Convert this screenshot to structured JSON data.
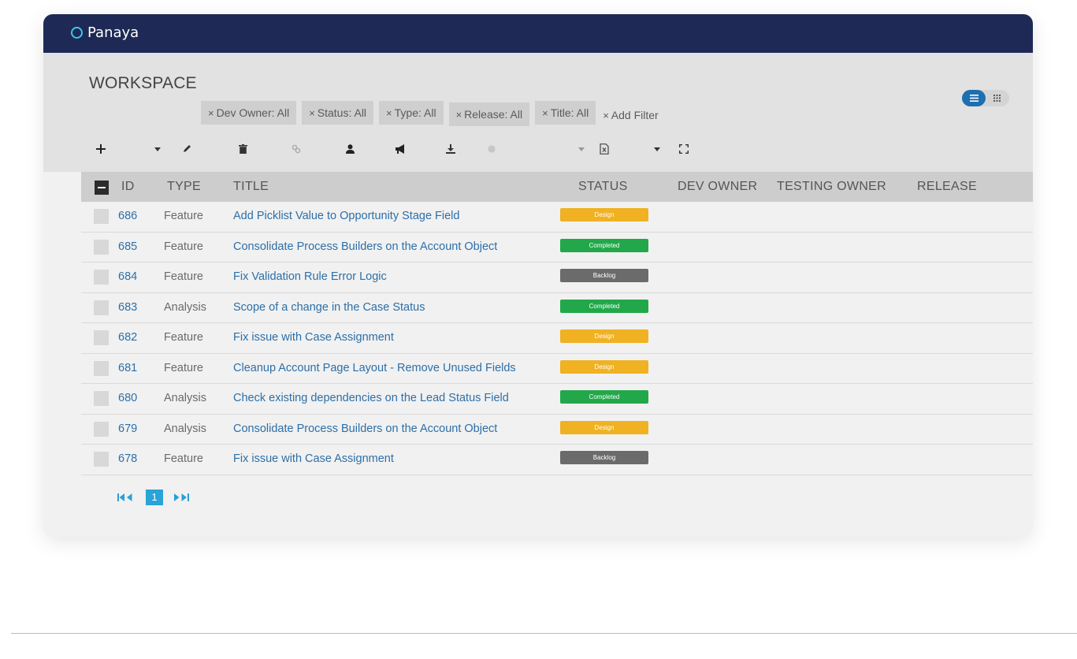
{
  "app": {
    "logo_text": "Panaya"
  },
  "workspace": {
    "title": "WORKSPACE"
  },
  "filters": [
    {
      "label": "Dev Owner: All"
    },
    {
      "label": "Status: All"
    },
    {
      "label": "Type: All"
    },
    {
      "label": "Release: All"
    },
    {
      "label": "Title: All"
    }
  ],
  "add_filter_label": "Add Filter",
  "remove_glyph": "×",
  "view_toggle": {
    "active": "list"
  },
  "toolbar_icons": [
    "plus-icon",
    "dropdown-caret-icon",
    "pencil-icon",
    "trash-icon",
    "link-icon",
    "user-icon",
    "megaphone-icon",
    "download-icon",
    "record-icon",
    "dropdown-caret-icon",
    "excel-icon",
    "dropdown-caret-icon",
    "fullscreen-icon"
  ],
  "table": {
    "columns": [
      "ID",
      "TYPE",
      "TITLE",
      "STATUS",
      "DEV OWNER",
      "TESTING OWNER",
      "RELEASE"
    ],
    "rows": [
      {
        "id": "686",
        "type": "Feature",
        "title": "Add Picklist Value to Opportunity Stage Field",
        "status": "Design"
      },
      {
        "id": "685",
        "type": "Feature",
        "title": "Consolidate Process Builders on the Account Object",
        "status": "Completed"
      },
      {
        "id": "684",
        "type": "Feature",
        "title": "Fix Validation Rule Error Logic",
        "status": "Backlog"
      },
      {
        "id": "683",
        "type": "Analysis",
        "title": "Scope of a change in the Case Status",
        "status": "Completed"
      },
      {
        "id": "682",
        "type": "Feature",
        "title": "Fix issue with Case Assignment",
        "status": "Design"
      },
      {
        "id": "681",
        "type": "Feature",
        "title": "Cleanup Account Page Layout - Remove Unused Fields",
        "status": "Design"
      },
      {
        "id": "680",
        "type": "Analysis",
        "title": "Check existing dependencies on the Lead Status Field",
        "status": "Completed"
      },
      {
        "id": "679",
        "type": "Analysis",
        "title": "Consolidate Process Builders on the Account Object",
        "status": "Design"
      },
      {
        "id": "678",
        "type": "Feature",
        "title": "Fix issue with Case Assignment",
        "status": "Backlog"
      }
    ]
  },
  "status_colors": {
    "Design": "#f0b122",
    "Completed": "#22a84a",
    "Backlog": "#6b6b6b"
  },
  "pagination": {
    "current_page": "1"
  },
  "colors": {
    "topbar": "#1e2a55",
    "accent": "#29a3d8",
    "link": "#2c6fa8"
  }
}
